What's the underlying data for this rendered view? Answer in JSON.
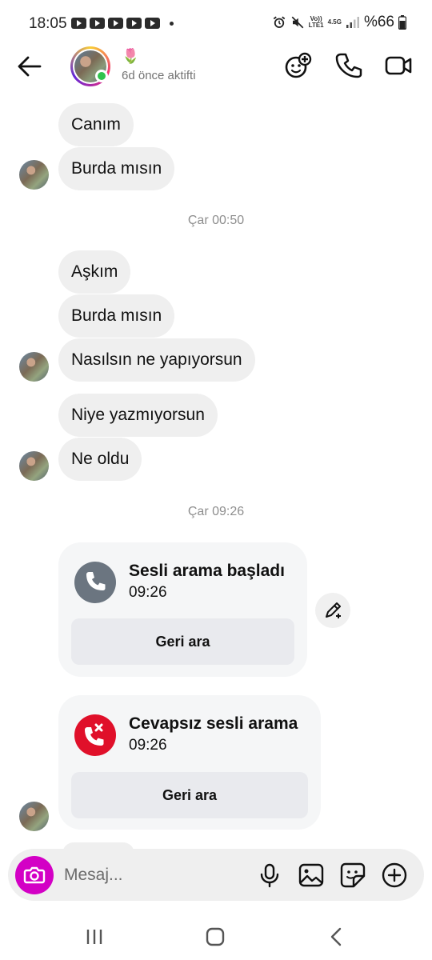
{
  "status_bar": {
    "time": "18:05",
    "network_top": "Vo))",
    "network_bottom": "LTE1",
    "network_type": "4.5G",
    "battery": "%66"
  },
  "header": {
    "flower": "🌷",
    "status": "6d önce aktifti",
    "icons": [
      "back-arrow-icon",
      "add-people-icon",
      "phone-icon",
      "video-camera-icon"
    ]
  },
  "messages": {
    "group1": [
      "Canım",
      "Burda mısın"
    ],
    "timestamp1": "Çar 00:50",
    "group2": [
      "Aşkım",
      "Burda mısın",
      "Nasılsın ne yapıyorsun"
    ],
    "group3": [
      "Niye yazmıyorsun",
      "Ne oldu"
    ],
    "timestamp2": "Çar 09:26"
  },
  "calls": [
    {
      "title": "Sesli arama başladı",
      "time": "09:26",
      "button": "Geri ara",
      "status": "started"
    },
    {
      "title": "Cevapsız sesli arama",
      "time": "09:26",
      "button": "Geri ara",
      "status": "missed"
    }
  ],
  "composer": {
    "placeholder": "Mesaj...",
    "icons": [
      "camera-icon",
      "microphone-icon",
      "gallery-icon",
      "sticker-icon",
      "plus-icon"
    ]
  },
  "colors": {
    "bubble": "#efefef",
    "camera_button": "#d300c5",
    "missed_call": "#e0102a",
    "started_call": "#6b7580",
    "online": "#31c24d"
  }
}
